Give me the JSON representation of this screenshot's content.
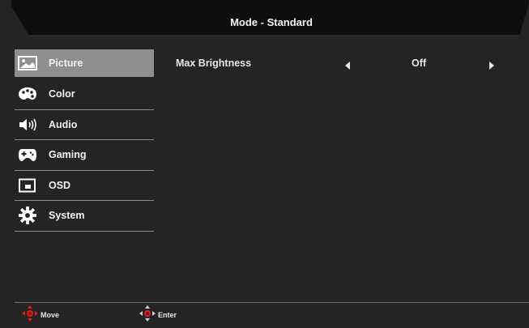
{
  "header": {
    "title": "Mode - Standard"
  },
  "menu": {
    "items": [
      {
        "label": "Picture",
        "icon": "picture-icon",
        "active": true
      },
      {
        "label": "Color",
        "icon": "palette-icon",
        "active": false
      },
      {
        "label": "Audio",
        "icon": "speaker-icon",
        "active": false
      },
      {
        "label": "Gaming",
        "icon": "gamepad-icon",
        "active": false
      },
      {
        "label": "OSD",
        "icon": "osd-window-icon",
        "active": false
      },
      {
        "label": "System",
        "icon": "gear-icon",
        "active": false
      }
    ]
  },
  "settings": [
    {
      "label": "Max Brightness",
      "value": "Off"
    }
  ],
  "footer": {
    "move_label": "Move",
    "enter_label": "Enter"
  },
  "colors": {
    "background": "#242424",
    "active_item": "#8f8f8f",
    "accent_red": "#e02020",
    "text": "#f2f2f2"
  }
}
